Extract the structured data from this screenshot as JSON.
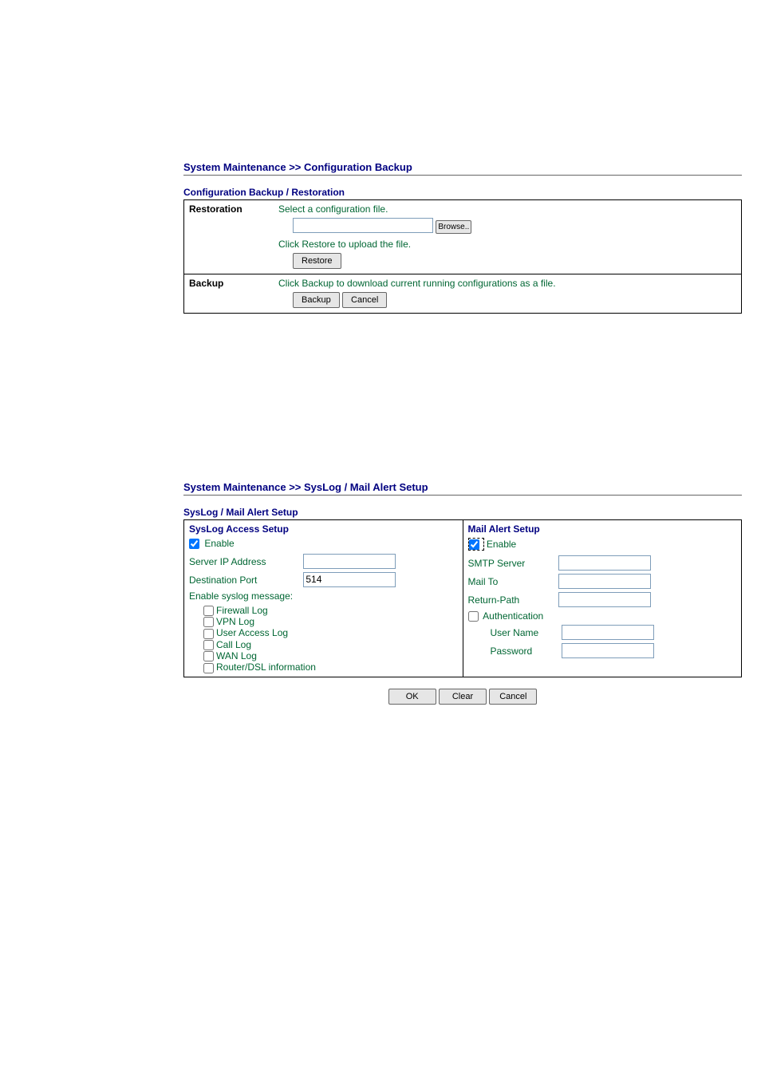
{
  "section1": {
    "title": "System Maintenance >> Configuration Backup",
    "subtitle": "Configuration Backup / Restoration",
    "restoration": {
      "header": "Restoration",
      "select_text": "Select a configuration file.",
      "browse_button": "Browse..",
      "upload_text": "Click Restore to upload the file.",
      "restore_button": "Restore"
    },
    "backup": {
      "header": "Backup",
      "text": "Click Backup to download current running configurations as a file.",
      "backup_button": "Backup",
      "cancel_button": "Cancel"
    }
  },
  "section2": {
    "title": "System Maintenance >> SysLog / Mail Alert Setup",
    "subtitle": "SysLog / Mail Alert Setup",
    "syslog": {
      "heading": "SysLog Access Setup",
      "enable_label": "Enable",
      "enable_checked": true,
      "server_ip_label": "Server IP Address",
      "server_ip_value": "",
      "dest_port_label": "Destination Port",
      "dest_port_value": "514",
      "message_label": "Enable syslog message:",
      "items": [
        {
          "label": "Firewall Log",
          "checked": false
        },
        {
          "label": "VPN Log",
          "checked": false
        },
        {
          "label": "User Access Log",
          "checked": false
        },
        {
          "label": "Call Log",
          "checked": false
        },
        {
          "label": "WAN Log",
          "checked": false
        },
        {
          "label": "Router/DSL information",
          "checked": false
        }
      ]
    },
    "mail": {
      "heading": "Mail Alert Setup",
      "enable_label": "Enable",
      "enable_checked": true,
      "smtp_label": "SMTP Server",
      "smtp_value": "",
      "mail_to_label": "Mail To",
      "mail_to_value": "",
      "return_path_label": "Return-Path",
      "return_path_value": "",
      "auth_label": "Authentication",
      "auth_checked": false,
      "user_label": "User Name",
      "user_value": "",
      "pass_label": "Password",
      "pass_value": ""
    },
    "buttons": {
      "ok": "OK",
      "clear": "Clear",
      "cancel": "Cancel"
    }
  }
}
